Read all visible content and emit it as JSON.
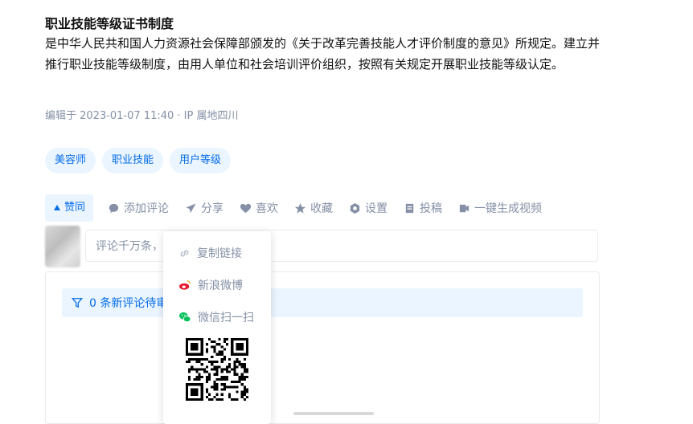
{
  "article": {
    "title": "职业技能等级证书制度",
    "paragraph": "是中华人民共和国人力资源社会保障部颁发的《关于改革完善技能人才评价制度的意见》所规定。建立并推行职业技能等级制度，由用人单位和社会培训评价组织，按照有关规定开展职业技能等级认定。",
    "meta": "编辑于 2023-01-07 11:40 · IP 属地四川",
    "tags": [
      "美容师",
      "职业技能",
      "用户等级"
    ]
  },
  "actions": {
    "vote": "赞同",
    "comment": "添加评论",
    "share": "分享",
    "like": "喜欢",
    "collect": "收藏",
    "settings": "设置",
    "submit": "投稿",
    "video": "一键生成视频"
  },
  "comment": {
    "placeholder": "评论千万条，",
    "notice": "0 条新评论待审"
  },
  "share_menu": {
    "copy_link": "复制链接",
    "weibo": "新浪微博",
    "wechat": "微信扫一扫"
  },
  "colors": {
    "accent": "#056de8",
    "muted": "#8590a6",
    "weibo": "#e6162d",
    "wechat": "#07c160"
  }
}
